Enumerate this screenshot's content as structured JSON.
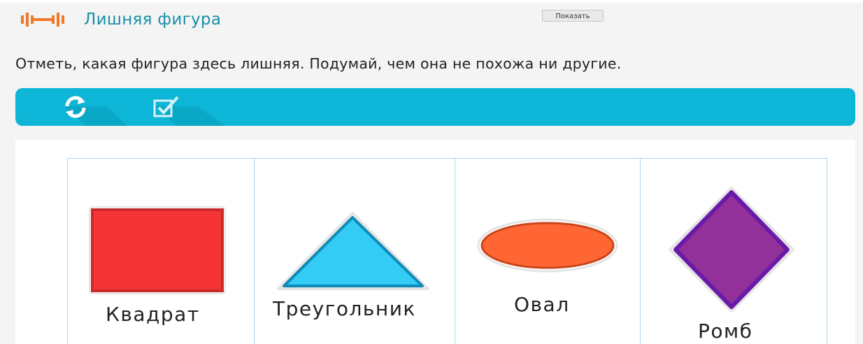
{
  "header": {
    "logo_icon": "orange-dumbbell-logo-icon",
    "title": "Лишняя фигура",
    "show_button": "Показать"
  },
  "instruction": "Отметь, какая фигура здесь лишняя. Подумай, чем она не похожа ни другие.",
  "toolbar": {
    "buttons": [
      {
        "icon": "refresh-icon"
      },
      {
        "icon": "checkbox-check-icon"
      }
    ],
    "color": "#0db5d6"
  },
  "cards": [
    {
      "label": "Квадрат",
      "shape": "square",
      "color": "#f53535",
      "border": "#c92a2a"
    },
    {
      "label": "Треугольник",
      "shape": "triangle",
      "color": "#33ccf5",
      "border": "#0f8ab8"
    },
    {
      "label": "Овал",
      "shape": "oval",
      "color": "#ff6633",
      "border": "#c9461a"
    },
    {
      "label": "Ромб",
      "shape": "rhombus",
      "color": "#93319a",
      "border": "#6a1aa8"
    }
  ],
  "colors": {
    "accent_title": "#1a8fa8",
    "logo": "#f07826",
    "card_border": "#a9dcec"
  }
}
